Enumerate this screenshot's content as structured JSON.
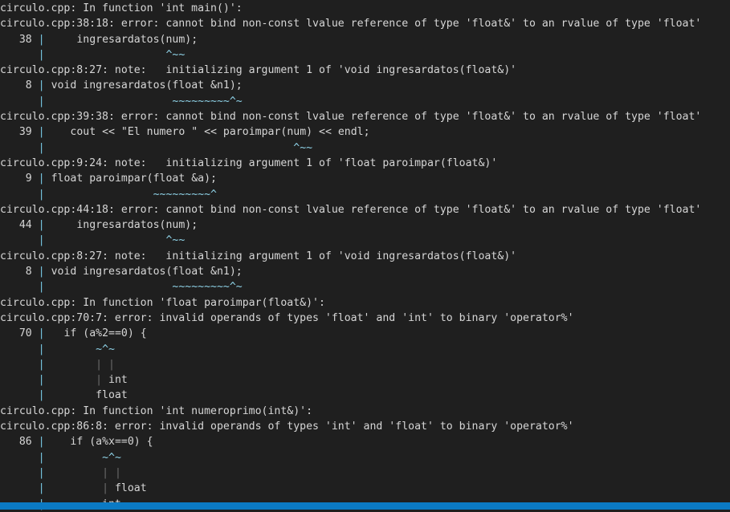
{
  "terminal": {
    "background_color": "#1f1f1f",
    "text_color": "#d6d6d6",
    "marker_color": "#8fd3e8",
    "gutter_pipe_color": "#76c5e0",
    "gutter_dim_color": "#6a6a6a",
    "status_bar_color": "#0b7ac4",
    "source_file": "circulo.cpp",
    "lines": [
      "circulo.cpp: In function 'int main()':",
      "circulo.cpp:38:18: error: cannot bind non-const lvalue reference of type 'float&' to an rvalue of type 'float'",
      "   38 |     ingresardatos(num);",
      "      |                   ^~~",
      "circulo.cpp:8:27: note:   initializing argument 1 of 'void ingresardatos(float&)'",
      "    8 | void ingresardatos(float &n1);",
      "      |                    ~~~~~~~~~^~",
      "circulo.cpp:39:38: error: cannot bind non-const lvalue reference of type 'float&' to an rvalue of type 'float'",
      "   39 |    cout << \"El numero \" << paroimpar(num) << endl;",
      "      |                                       ^~~",
      "circulo.cpp:9:24: note:   initializing argument 1 of 'float paroimpar(float&)'",
      "    9 | float paroimpar(float &a);",
      "      |                 ~~~~~~~~~^",
      "circulo.cpp:44:18: error: cannot bind non-const lvalue reference of type 'float&' to an rvalue of type 'float'",
      "   44 |     ingresardatos(num);",
      "      |                   ^~~",
      "circulo.cpp:8:27: note:   initializing argument 1 of 'void ingresardatos(float&)'",
      "    8 | void ingresardatos(float &n1);",
      "      |                    ~~~~~~~~~^~",
      "circulo.cpp: In function 'float paroimpar(float&)':",
      "circulo.cpp:70:7: error: invalid operands of types 'float' and 'int' to binary 'operator%'",
      "   70 |   if (a%2==0) {",
      "      |        ~^~",
      "      |        | |",
      "      |        | int",
      "      |        float",
      "circulo.cpp: In function 'int numeroprimo(int&)':",
      "circulo.cpp:86:8: error: invalid operands of types 'int' and 'float' to binary 'operator%'",
      "   86 |    if (a%x==0) {",
      "      |         ~^~",
      "      |         | |",
      "      |         | float",
      "      |         int"
    ]
  }
}
